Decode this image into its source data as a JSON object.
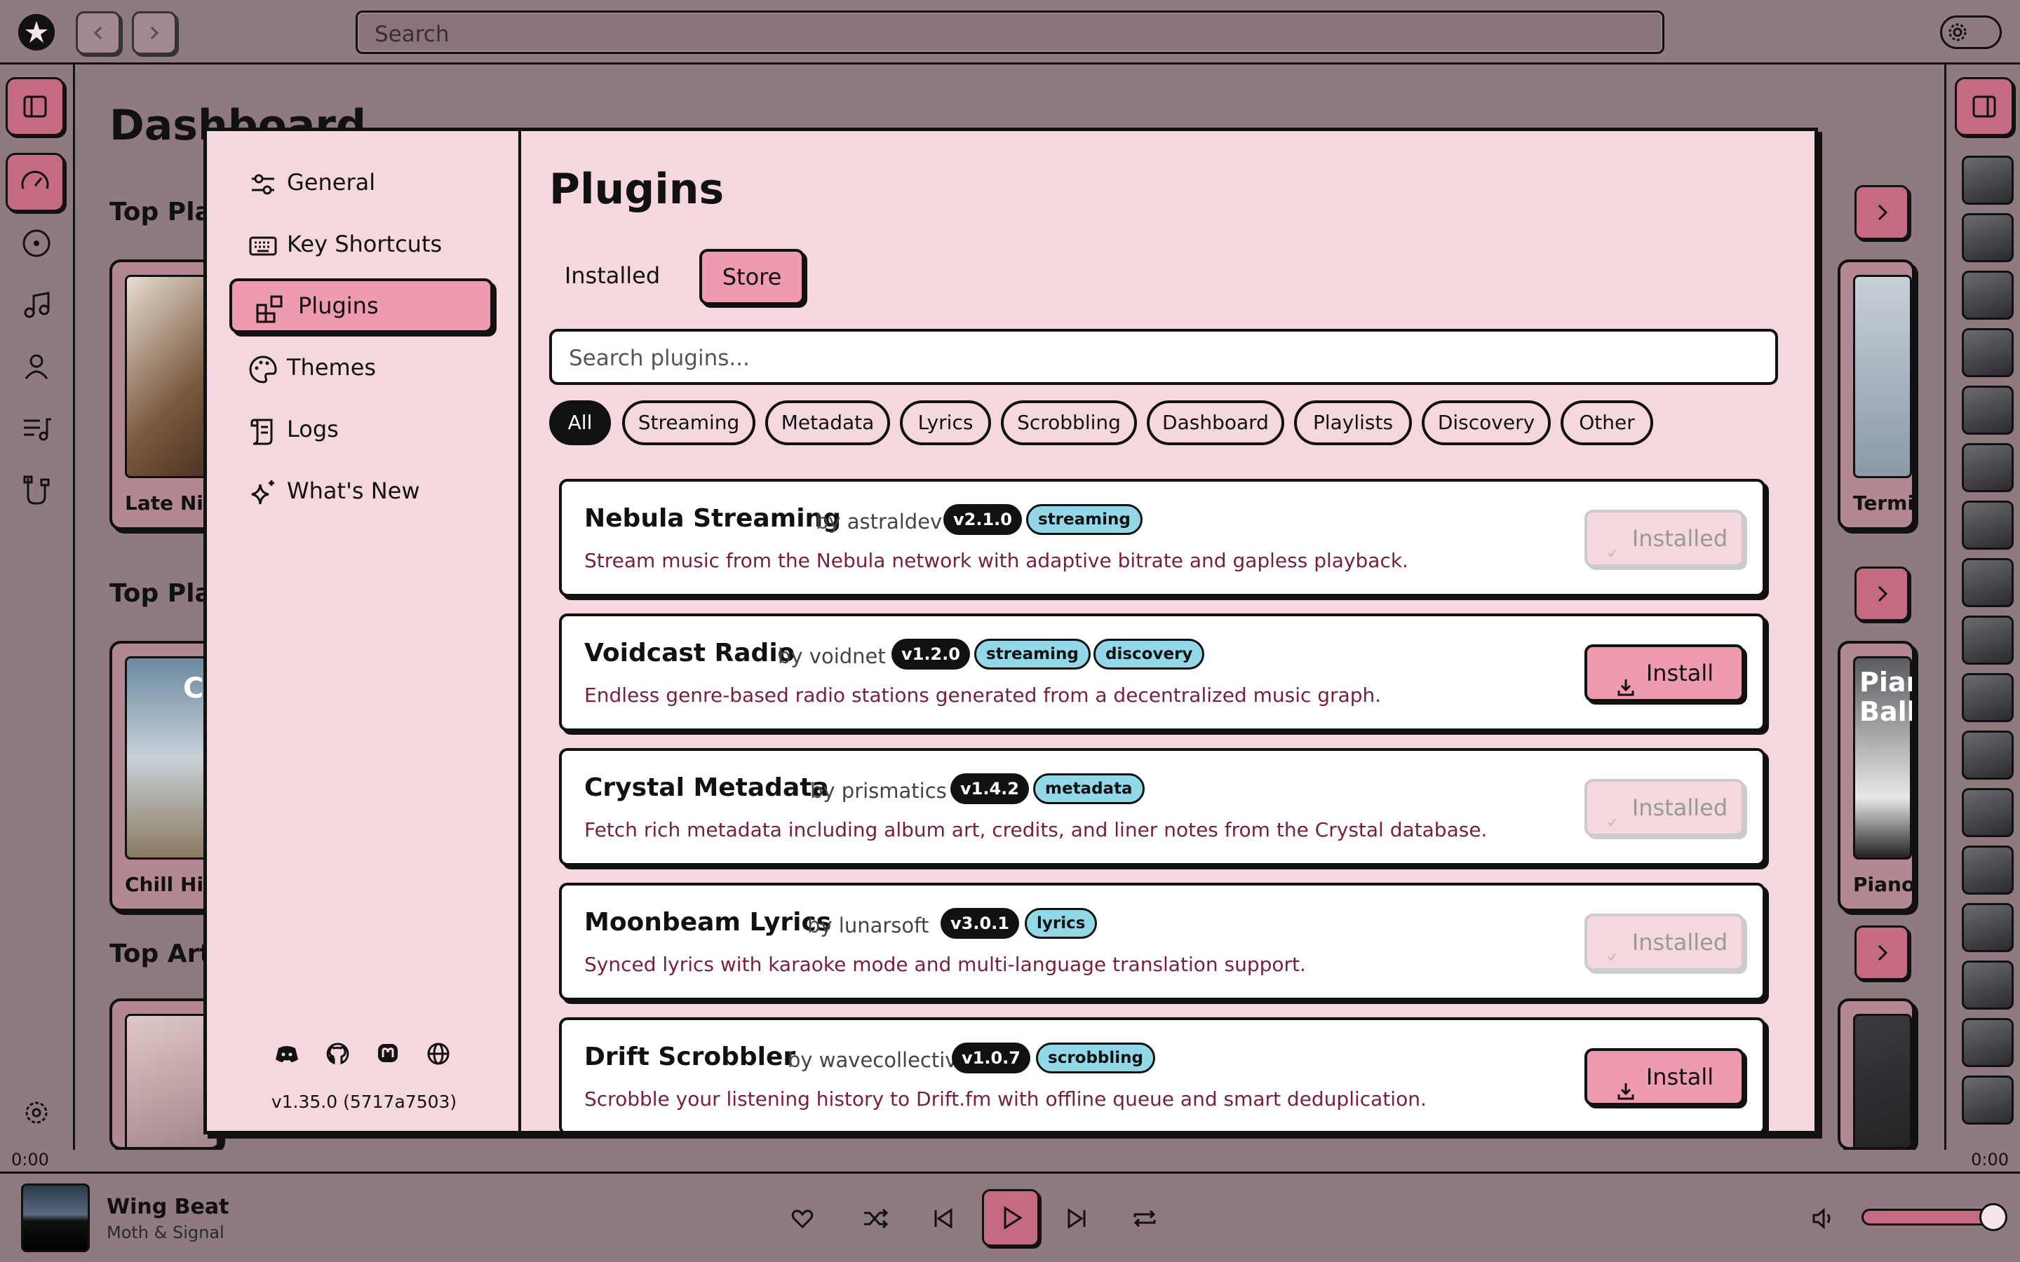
{
  "topbar": {
    "search_placeholder": "Search"
  },
  "dashboard": {
    "title": "Dashboard",
    "sections": [
      "Top Play",
      "Top Play",
      "Top Arti"
    ],
    "cards_left": [
      "Late Nig",
      "Chill Hits"
    ],
    "cards_right": [
      "Termin",
      "Piano"
    ],
    "card_art_text": [
      "Ch",
      "Pian",
      "Balla"
    ]
  },
  "modal": {
    "nav": [
      {
        "label": "General",
        "icon": "sliders-icon"
      },
      {
        "label": "Key Shortcuts",
        "icon": "keyboard-icon"
      },
      {
        "label": "Plugins",
        "icon": "plugins-icon"
      },
      {
        "label": "Themes",
        "icon": "palette-icon"
      },
      {
        "label": "Logs",
        "icon": "scroll-icon"
      },
      {
        "label": "What's New",
        "icon": "sparkles-icon"
      }
    ],
    "active_nav": "Plugins",
    "social_icons": [
      "discord-icon",
      "github-icon",
      "mastodon-icon",
      "globe-icon"
    ],
    "version": "v1.35.0 (5717a7503)",
    "title": "Plugins",
    "tabs": [
      "Installed",
      "Store"
    ],
    "active_tab": "Store",
    "search_placeholder": "Search plugins...",
    "filters": [
      "All",
      "Streaming",
      "Metadata",
      "Lyrics",
      "Scrobbling",
      "Dashboard",
      "Playlists",
      "Discovery",
      "Other"
    ],
    "active_filter": "All",
    "plugins": [
      {
        "name": "Nebula Streaming",
        "author": "by astraldev",
        "version": "v2.1.0",
        "tags": [
          "streaming"
        ],
        "description": "Stream music from the Nebula network with adaptive bitrate and gapless playback.",
        "action": "Installed"
      },
      {
        "name": "Voidcast Radio",
        "author": "by voidnet",
        "version": "v1.2.0",
        "tags": [
          "streaming",
          "discovery"
        ],
        "description": "Endless genre-based radio stations generated from a decentralized music graph.",
        "action": "Install"
      },
      {
        "name": "Crystal Metadata",
        "author": "by prismatics",
        "version": "v1.4.2",
        "tags": [
          "metadata"
        ],
        "description": "Fetch rich metadata including album art, credits, and liner notes from the Crystal database.",
        "action": "Installed"
      },
      {
        "name": "Moonbeam Lyrics",
        "author": "by lunarsoft",
        "version": "v3.0.1",
        "tags": [
          "lyrics"
        ],
        "description": "Synced lyrics with karaoke mode and multi-language translation support.",
        "action": "Installed"
      },
      {
        "name": "Drift Scrobbler",
        "author": "by wavecollective",
        "version": "v1.0.7",
        "tags": [
          "scrobbling"
        ],
        "description": "Scrobble your listening history to Drift.fm with offline queue and smart deduplication.",
        "action": "Install"
      }
    ]
  },
  "player": {
    "elapsed": "0:00",
    "duration": "0:00",
    "track_title": "Wing Beat",
    "track_artist": "Moth & Signal",
    "volume": 0.9
  },
  "colors": {
    "accent": "#ee9aaf",
    "backdrop": "#8f7a80",
    "tag": "#92d8e8",
    "description": "#7a1f36"
  }
}
